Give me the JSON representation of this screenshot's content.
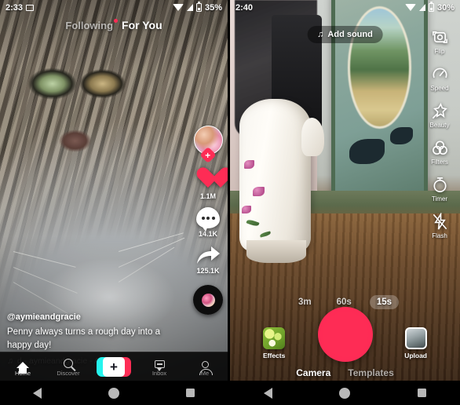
{
  "left_phone": {
    "status_bar": {
      "time": "2:33",
      "battery_percent": "35%",
      "icons": [
        "cast-icon",
        "wifi-icon",
        "signal-icon",
        "battery-icon"
      ]
    },
    "feed_tabs": [
      {
        "label": "Following",
        "active": false,
        "has_badge": true
      },
      {
        "label": "For You",
        "active": true,
        "has_badge": false
      }
    ],
    "action_rail": {
      "avatar": {
        "name": "avatar",
        "follow_badge": "+"
      },
      "like": {
        "icon": "heart-icon",
        "count": "1.1M"
      },
      "comment": {
        "icon": "comment-icon",
        "count": "14.1K"
      },
      "share": {
        "icon": "share-icon",
        "count": "125.1K"
      },
      "sound_disc": "music-disc-icon"
    },
    "caption": {
      "username": "@aymieandgracie",
      "text": "Penny always turns a rough day into a happy day!",
      "music_note": "♫",
      "music": "d - aymieandgracie - A"
    },
    "bottom_nav": [
      {
        "label": "Home",
        "icon": "home-icon",
        "active": true
      },
      {
        "label": "Discover",
        "icon": "search-icon",
        "active": false
      },
      {
        "label": "",
        "icon": "create-plus-icon",
        "active": false
      },
      {
        "label": "Inbox",
        "icon": "inbox-icon",
        "active": false
      },
      {
        "label": "Me",
        "icon": "person-icon",
        "active": false
      }
    ]
  },
  "right_phone": {
    "status_bar": {
      "time": "2:40",
      "battery_percent": "30%",
      "icons": [
        "wifi-icon",
        "signal-icon",
        "battery-icon"
      ]
    },
    "add_sound": {
      "label": "Add sound",
      "note": "♫"
    },
    "tool_rail": [
      {
        "label": "Flip",
        "icon": "flip-camera-icon"
      },
      {
        "label": "Speed",
        "icon": "speed-icon"
      },
      {
        "label": "Beauty",
        "icon": "beauty-wand-icon"
      },
      {
        "label": "Filters",
        "icon": "filters-icon"
      },
      {
        "label": "Timer",
        "icon": "timer-icon"
      },
      {
        "label": "Flash",
        "icon": "flash-off-icon"
      }
    ],
    "durations": [
      {
        "label": "3m",
        "selected": false
      },
      {
        "label": "60s",
        "selected": false
      },
      {
        "label": "15s",
        "selected": true
      }
    ],
    "effects_button": {
      "label": "Effects",
      "icon": "effects-icon"
    },
    "upload_button": {
      "label": "Upload",
      "icon": "upload-thumbnail-icon"
    },
    "record_button": {
      "name": "record-button"
    },
    "modes": [
      {
        "label": "Camera",
        "active": true
      },
      {
        "label": "Templates",
        "active": false
      }
    ]
  },
  "system_nav": {
    "back": "back-triangle-icon",
    "home": "home-circle-icon",
    "recents": "recents-square-icon"
  },
  "colors": {
    "accent_red": "#fe2c55",
    "accent_cyan": "#25f4ee"
  }
}
